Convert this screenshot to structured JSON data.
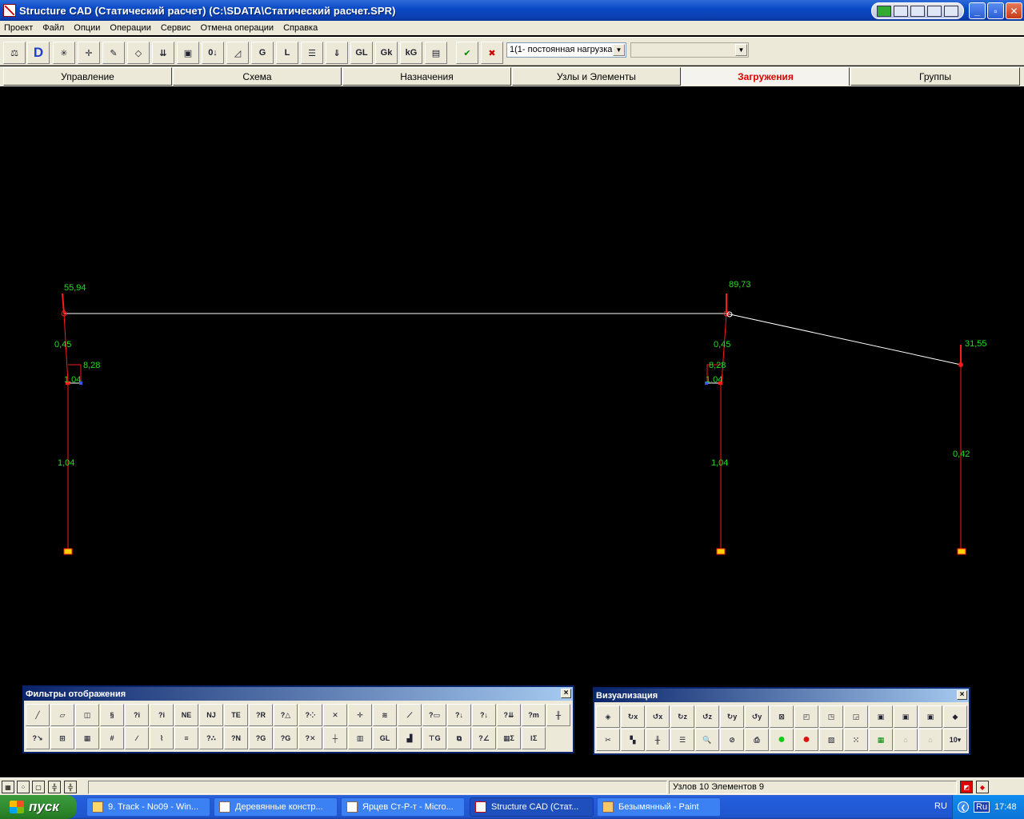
{
  "window": {
    "title": "Structure CAD (Статический расчет) (C:\\SDATA\\Статический расчет.SPR)"
  },
  "menu": [
    "Проект",
    "Файл",
    "Опции",
    "Операции",
    "Сервис",
    "Отмена операции",
    "Справка"
  ],
  "toolbar": {
    "load_case_value": "1(1- постоянная нагрузка)",
    "second_combo_value": ""
  },
  "tabs": [
    {
      "label": "Управление"
    },
    {
      "label": "Схема"
    },
    {
      "label": "Назначения"
    },
    {
      "label": "Узлы и Элементы"
    },
    {
      "label": "Загружения"
    },
    {
      "label": "Группы"
    }
  ],
  "active_tab": "Загружения",
  "diagram": {
    "labels": [
      "55,94",
      "89,73",
      "31,55",
      "0,45",
      "0,45",
      "8,28",
      "8,28",
      "1,04",
      "1,04",
      "1,04",
      "1,04",
      "0,42"
    ]
  },
  "palettes": {
    "filters_title": "Фильтры отображения",
    "visualization_title": "Визуализация",
    "close_glyph": "×"
  },
  "statusbar": {
    "info": "Узлов 10 Элементов 9"
  },
  "taskbar": {
    "start_label": "пуск",
    "tasks": [
      {
        "label": "9. Track - No09 - Win..."
      },
      {
        "label": "Деревянные констр..."
      },
      {
        "label": "Ярцев Ст-Р-т - Micro..."
      },
      {
        "label": "Structure CAD (Стат..."
      },
      {
        "label": "Безымянный - Paint"
      }
    ],
    "lang": "RU",
    "lang_indicator": "Ru",
    "clock": "17:48"
  },
  "colors": {
    "canvas": "#000000",
    "member_red": "#ff1a1a",
    "member_white": "#ffffff",
    "label_green": "#22dd22",
    "node_yellow": "#ffd000",
    "active_tab_text": "#e00000"
  }
}
